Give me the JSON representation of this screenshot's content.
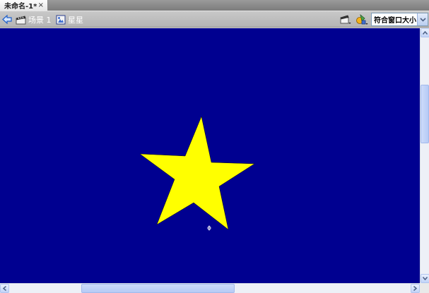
{
  "document_tab": {
    "title": "未命名-1*",
    "close_label": "×"
  },
  "edit_bar": {
    "scene_label": "场景 1",
    "symbol_label": "星星",
    "zoom_value": "符合窗口大小"
  },
  "stage": {
    "background_color": "#000090",
    "star_color": "#FFFF00"
  },
  "icons": {
    "back": "back-arrow-icon",
    "scene": "scene-clapper-icon",
    "symbol": "graphic-symbol-icon",
    "edit_scene": "edit-scene-icon",
    "edit_symbol": "edit-symbol-icon",
    "registration": "registration-point-icon"
  }
}
